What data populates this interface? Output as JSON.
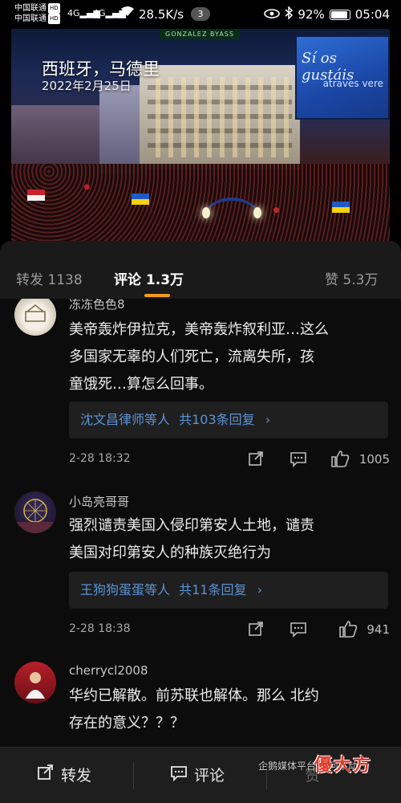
{
  "status_bar": {
    "carrier1": "中国联通",
    "carrier2": "中国联通",
    "hd": "HD",
    "net1": "4G",
    "net2": "4G",
    "speed": "28.5K/s",
    "notif_count": "3",
    "battery": "92%",
    "time": "05:04"
  },
  "hero": {
    "location": "西班牙，马德里",
    "date": "2022年2月25日",
    "sign_text": "GONZALEZ BYASS",
    "billboard_text": "Sí os gustáis",
    "billboard_sub": "atraves vere"
  },
  "tabs": [
    {
      "label": "转发",
      "count": "1138"
    },
    {
      "label": "评论",
      "count": "1.3万"
    },
    {
      "label": "赞",
      "count": "5.3万"
    }
  ],
  "comments": [
    {
      "username": "冻冻色色8",
      "text_lines": [
        "美帝轰炸伊拉克，美帝轰炸叙利亚…这么",
        "多国家无辜的人们死亡，流离失所，孩",
        "童饿死…算怎么回事。"
      ],
      "reply_users": "沈文昌律师等人",
      "reply_count": "共103条回复",
      "time": "2-28 18:32",
      "likes": "1005"
    },
    {
      "username": "小岛亮哥哥",
      "text_lines": [
        "强烈谴责美国入侵印第安人土地，谴责",
        "美国对印第安人的种族灭绝行为"
      ],
      "reply_users": "王狗狗蛋蛋等人",
      "reply_count": "共11条回复",
      "time": "2-28 18:38",
      "likes": "941"
    },
    {
      "username": "cherrycl2008",
      "text_lines": [
        "华约已解散。前苏联也解体。那么 北约",
        "存在的意义？？？"
      ]
    }
  ],
  "bottom_bar": {
    "repost": "转发",
    "comment": "评论",
    "like": "赞"
  },
  "watermark": {
    "text": "企鹅媒体平台 星河不动",
    "logo": "優大方"
  },
  "colors": {
    "accent": "#f39a1f",
    "link": "#5b93d6",
    "background": "#0c0c0c"
  }
}
